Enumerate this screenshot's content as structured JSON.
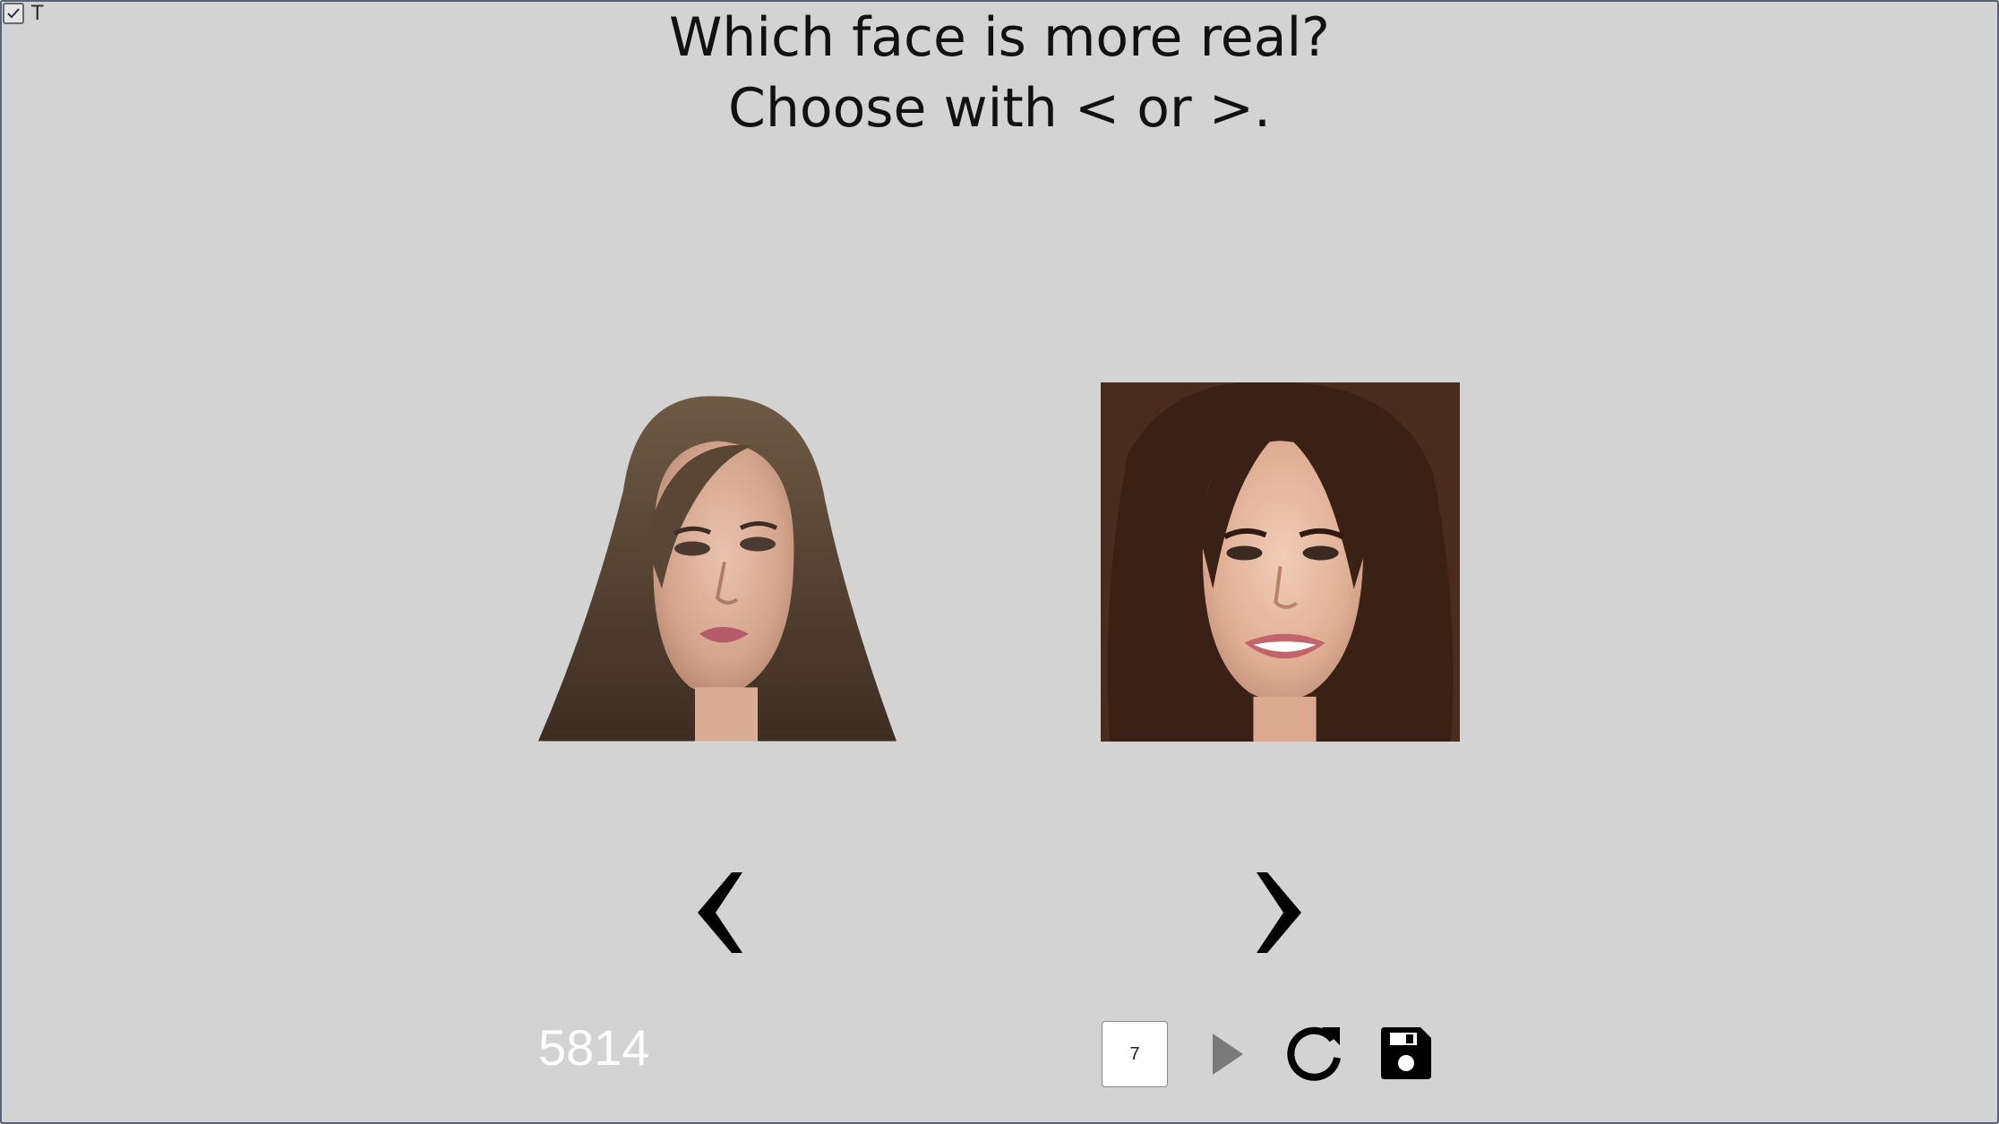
{
  "header": {
    "line1": "Which face is more real?",
    "line2": "Choose with < or >."
  },
  "corner": {
    "label": "T",
    "checkbox_checked": true
  },
  "faces": {
    "left": {
      "icon": "face-photo-icon"
    },
    "right": {
      "icon": "face-photo-icon"
    }
  },
  "arrows": {
    "left": "chevron-left-icon",
    "right": "chevron-right-icon"
  },
  "footer": {
    "score": "5814",
    "count_value": "7",
    "play_icon": "play-icon",
    "reload_icon": "reload-icon",
    "save_icon": "floppy-disk-icon"
  },
  "colors": {
    "background": "#d3d3d3",
    "text": "#111111",
    "score_text": "#ffffff",
    "play_icon": "#7a7a7a"
  }
}
